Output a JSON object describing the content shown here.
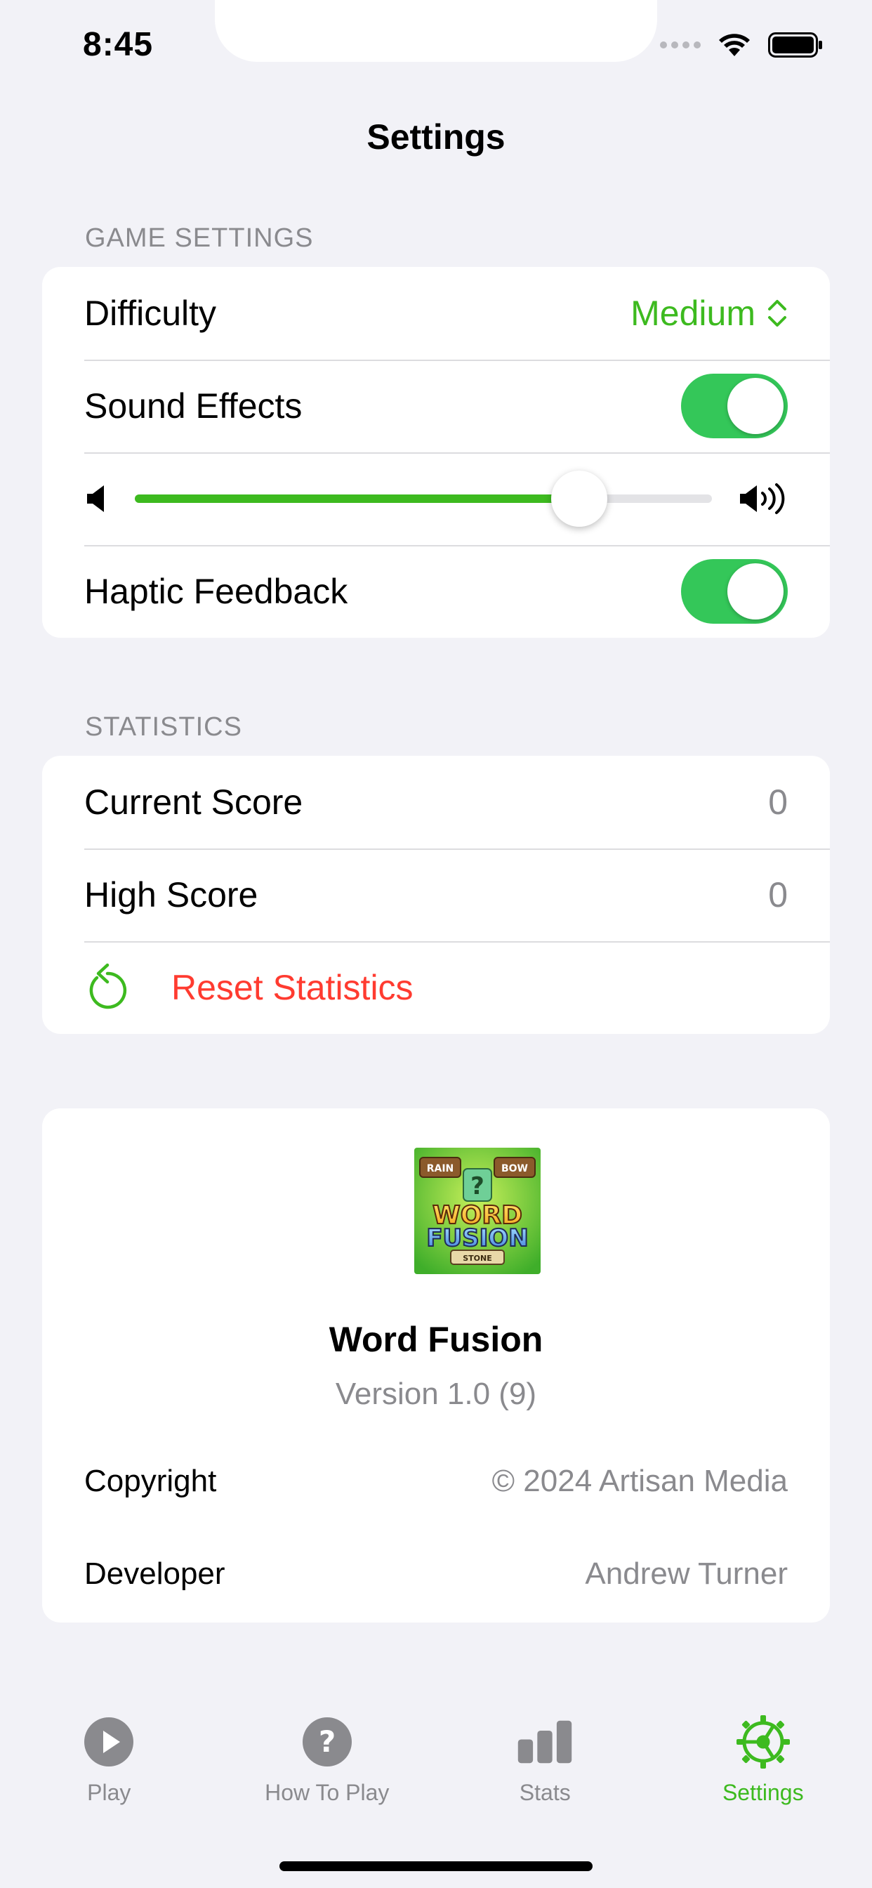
{
  "status_bar": {
    "time": "8:45"
  },
  "header": {
    "title": "Settings"
  },
  "game_settings": {
    "section_title": "GAME SETTINGS",
    "difficulty_label": "Difficulty",
    "difficulty_value": "Medium",
    "sound_effects_label": "Sound Effects",
    "sound_effects_on": true,
    "volume_level": 0.77,
    "haptic_feedback_label": "Haptic Feedback",
    "haptic_feedback_on": true
  },
  "statistics": {
    "section_title": "STATISTICS",
    "current_score_label": "Current Score",
    "current_score_value": "0",
    "high_score_label": "High Score",
    "high_score_value": "0",
    "reset_label": "Reset Statistics"
  },
  "about": {
    "app_icon_text": [
      "RAIN",
      "BOW",
      "?",
      "WORD",
      "FUSION",
      "STONE"
    ],
    "app_name": "Word Fusion",
    "version": "Version 1.0 (9)",
    "copyright_label": "Copyright",
    "copyright_value": "© 2024 Artisan Media",
    "developer_label": "Developer",
    "developer_value": "Andrew Turner"
  },
  "tabbar": {
    "tabs": [
      {
        "label": "Play",
        "icon": "play-icon",
        "active": false
      },
      {
        "label": "How To Play",
        "icon": "question-icon",
        "active": false
      },
      {
        "label": "Stats",
        "icon": "bar-chart-icon",
        "active": false
      },
      {
        "label": "Settings",
        "icon": "gear-icon",
        "active": true
      }
    ]
  },
  "colors": {
    "accent": "#3dba1f",
    "toggle_on": "#34c759",
    "destructive": "#ff3b30",
    "secondary_text": "#8a8a8e",
    "background": "#f2f2f7"
  }
}
